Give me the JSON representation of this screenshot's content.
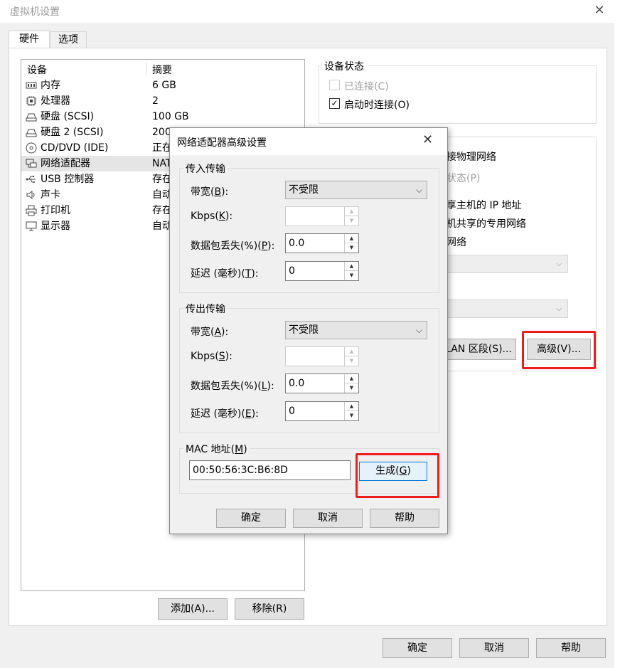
{
  "window": {
    "title": "虚拟机设置",
    "close_glyph": "✕",
    "tabs": [
      "硬件",
      "选项"
    ],
    "footer_buttons": [
      "确定",
      "取消",
      "帮助"
    ]
  },
  "devices": {
    "columns": [
      "设备",
      "摘要"
    ],
    "rows": [
      {
        "name": "内存",
        "summary": "6 GB",
        "icon": "memory-icon"
      },
      {
        "name": "处理器",
        "summary": "2",
        "icon": "cpu-icon"
      },
      {
        "name": "硬盘 (SCSI)",
        "summary": "100 GB",
        "icon": "hard-disk-icon"
      },
      {
        "name": "硬盘 2 (SCSI)",
        "summary": "200",
        "icon": "hard-disk-icon"
      },
      {
        "name": "CD/DVD (IDE)",
        "summary": "正在",
        "icon": "cd-dvd-icon"
      },
      {
        "name": "网络适配器",
        "summary": "NAT",
        "icon": "network-adapter-icon",
        "selected": true
      },
      {
        "name": "USB 控制器",
        "summary": "存在",
        "icon": "usb-icon"
      },
      {
        "name": "声卡",
        "summary": "自动",
        "icon": "speaker-icon"
      },
      {
        "name": "打印机",
        "summary": "存在",
        "icon": "printer-icon"
      },
      {
        "name": "显示器",
        "summary": "自动",
        "icon": "monitor-icon"
      }
    ],
    "add_button": "添加(A)...",
    "remove_button": "移除(R)"
  },
  "device_status": {
    "title": "设备状态",
    "connected": {
      "label": "已连接(C)",
      "checked": false,
      "disabled": true
    },
    "connect_at_power_on": {
      "label": "启动时连接(O)",
      "checked": true
    }
  },
  "network_connection": {
    "bridged_tail": "接物理网络",
    "replicate_tail": "状态(P)",
    "nat_tail": "享主机的 IP 地址",
    "hostonly_tail": "机共享的专用网络",
    "custom_tail": "网络",
    "lan_segments_button": "LAN 区段(S)...",
    "advanced_button": "高级(V)..."
  },
  "advanced_dialog": {
    "title": "网络适配器高级设置",
    "close_glyph": "✕",
    "incoming": {
      "title": "传入传输",
      "bandwidth_label": "带宽(",
      "bandwidth_key": "B",
      "bandwidth_value": "不受限",
      "kbps_label": "Kbps(",
      "kbps_key": "K",
      "kbps_value": "",
      "loss_label": "数据包丢失(%)(",
      "loss_key": "P",
      "loss_value": "0.0",
      "latency_label": "延迟 (毫秒)(",
      "latency_key": "T",
      "latency_value": "0"
    },
    "outgoing": {
      "title": "传出传输",
      "bandwidth_label": "带宽(",
      "bandwidth_key": "A",
      "bandwidth_value": "不受限",
      "kbps_label": "Kbps(",
      "kbps_key": "S",
      "kbps_value": "",
      "loss_label": "数据包丢失(%)(",
      "loss_key": "L",
      "loss_value": "0.0",
      "latency_label": "延迟 (毫秒)(",
      "latency_key": "E",
      "latency_value": "0"
    },
    "mac": {
      "label": "MAC 地址(",
      "key": "M",
      "value": "00:50:56:3C:B6:8D",
      "generate_label": "生成(",
      "generate_key": "G"
    },
    "buttons": [
      "确定",
      "取消",
      "帮助"
    ]
  },
  "colors": {
    "highlight": "#ee1c1c",
    "selected_row": "#e5e5e5",
    "generate_button_bg": "#e5f1fb",
    "generate_button_border": "#0078d7"
  }
}
